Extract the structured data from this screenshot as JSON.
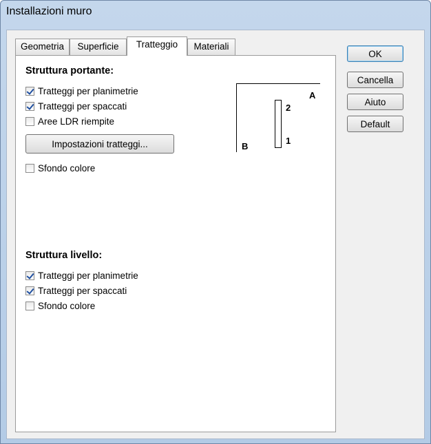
{
  "window": {
    "title": "Installazioni muro"
  },
  "tabs": [
    {
      "label": "Geometria"
    },
    {
      "label": "Superficie"
    },
    {
      "label": "Tratteggio",
      "active": true
    },
    {
      "label": "Materiali"
    }
  ],
  "struttura_portante": {
    "title": "Struttura portante:",
    "checkboxes": [
      {
        "label": "Tratteggi per planimetrie",
        "checked": true
      },
      {
        "label": "Tratteggi per spaccati",
        "checked": true
      },
      {
        "label": "Aree LDR riempite",
        "checked": false
      }
    ],
    "settings_button": "Impostazioni tratteggi...",
    "sfondo": {
      "label": "Sfondo colore",
      "checked": false
    }
  },
  "preview": {
    "label_a": "A",
    "label_b": "B",
    "label_1": "1",
    "label_2": "2"
  },
  "struttura_livello": {
    "title": "Struttura livello:",
    "checkboxes": [
      {
        "label": "Tratteggi per planimetrie",
        "checked": true
      },
      {
        "label": "Tratteggi per spaccati",
        "checked": true
      },
      {
        "label": "Sfondo colore",
        "checked": false
      }
    ]
  },
  "buttons": {
    "ok": "OK",
    "cancel": "Cancella",
    "help": "Aiuto",
    "default": "Default"
  }
}
